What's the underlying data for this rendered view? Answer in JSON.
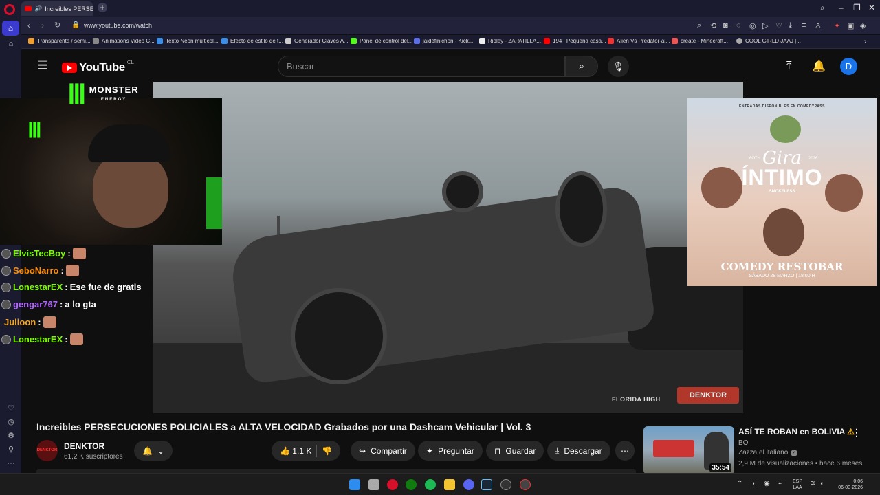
{
  "browser": {
    "tab_title": "Increibles PERSECUCIO",
    "url": "www.youtube.com/watch",
    "ai_label": "AI",
    "bookmarks": [
      "Transparenta / semi...",
      "Animations Video C...",
      "Texto Neón multicol...",
      "Efecto de estilo de t...",
      "Generador Claves A...",
      "Panel de control del...",
      "jaidefinichon - Kick...",
      "Ripley - ZAPATILLA...",
      "194 | Pequeña casa...",
      "Alien Vs Predator-al...",
      "create - Minecraft...",
      "COOL GIRLD JAAJ |..."
    ]
  },
  "youtube": {
    "logo_text": "YouTube",
    "country_code": "CL",
    "search_placeholder": "Buscar",
    "avatar_letter": "D"
  },
  "overlay": {
    "brand_name": "MONSTER",
    "brand_sub": "ENERGY",
    "chat": [
      {
        "user": "ElvisTecBoy",
        "color": "#7cfc00",
        "message": "",
        "emote": true
      },
      {
        "user": "SeboNarro",
        "color": "#ff8c00",
        "message": "",
        "emote": true
      },
      {
        "user": "LonestarEX",
        "color": "#7cfc00",
        "message": "Ese fue de gratis",
        "emote": false
      },
      {
        "user": "gengar767",
        "color": "#b266ff",
        "message": "a lo gta",
        "emote": false
      },
      {
        "user": "Julioon",
        "color": "#f5a623",
        "message": "",
        "emote": true
      },
      {
        "user": "LonestarEX",
        "color": "#7cfc00",
        "message": "",
        "emote": true
      }
    ]
  },
  "video": {
    "watermark_source": "FLORIDA HIGH",
    "watermark_channel": "DENKTOR",
    "title": "Increibles PERSECUCIONES POLICIALES a ALTA VELOCIDAD Grabados por una Dashcam Vehicular | Vol. 3",
    "channel_name": "DENKTOR",
    "channel_avatar_text": "DENKTOR",
    "subscribers": "61,2 K suscriptores",
    "likes": "1,1 K",
    "share_label": "Compartir",
    "ask_label": "Preguntar",
    "save_label": "Guardar",
    "download_label": "Descargar"
  },
  "poster": {
    "top_text": "ENTRADAS DISPONIBLES EN COMEDYPASS",
    "sixth": "6OTH",
    "year": "2026",
    "gira": "Gira",
    "intimo": "ÍNTIMO",
    "brand": "SMOKELESS",
    "venue": "COMEDY RESTOBAR",
    "date": "SÁBADO 28 MARZO | 18:00 H"
  },
  "recommendation": {
    "title": "ASÍ TE ROBAN en BOLIVIA",
    "warn": "⚠",
    "country": "BO",
    "channel": "Zazza el italiano",
    "views": "2,9 M de visualizaciones",
    "age": "hace 6 meses",
    "duration": "35:54"
  },
  "taskbar": {
    "lang_top": "ESP",
    "lang_bottom": "LAA",
    "time": "0:06",
    "date": "06-03-2026"
  }
}
